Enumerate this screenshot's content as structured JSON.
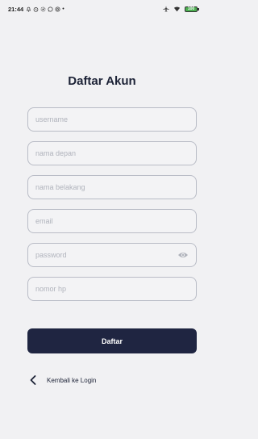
{
  "status_bar": {
    "time": "21:44",
    "battery": "100",
    "icons": [
      "notification-icon",
      "alarm-icon",
      "settings-icon",
      "whatsapp-icon",
      "chrome-icon",
      "airplane-icon",
      "wifi-icon",
      "battery-icon"
    ]
  },
  "page": {
    "title": "Daftar Akun"
  },
  "form": {
    "username_placeholder": "username",
    "first_name_placeholder": "nama depan",
    "last_name_placeholder": "nama belakang",
    "email_placeholder": "email",
    "password_placeholder": "password",
    "phone_placeholder": "nomor hp",
    "submit_label": "Daftar"
  },
  "nav": {
    "back_label": "Kembali ke Login"
  },
  "colors": {
    "background": "#f1f1f3",
    "primary": "#1f2541",
    "field_border": "#b9bcc6",
    "placeholder": "#b0b3bc"
  }
}
